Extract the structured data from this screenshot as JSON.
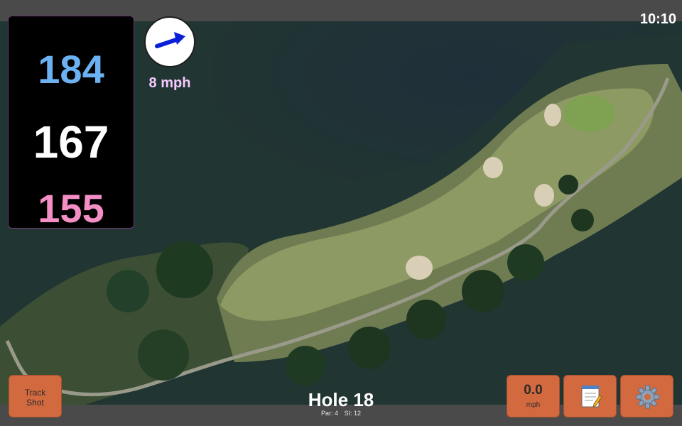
{
  "status": {
    "time": "10:10"
  },
  "distances": {
    "back": "184",
    "middle": "167",
    "front": "155"
  },
  "wind": {
    "speed_text": "8 mph",
    "direction_icon": "arrow-right-up-icon"
  },
  "hole": {
    "title": "Hole 18",
    "par_text": "Par: 4",
    "si_text": "SI: 12"
  },
  "buttons": {
    "track_shot_line1": "Track",
    "track_shot_line2": "Shot",
    "speed_value": "0.0",
    "speed_unit": "mph",
    "notes_icon": "notepad-icon",
    "settings_icon": "gear-icon"
  },
  "colors": {
    "back_distance": "#6cb2f3",
    "middle_distance": "#ffffff",
    "front_distance": "#f48fc6",
    "button": "#d2693f",
    "wind_arrow": "#0a1fd8"
  }
}
